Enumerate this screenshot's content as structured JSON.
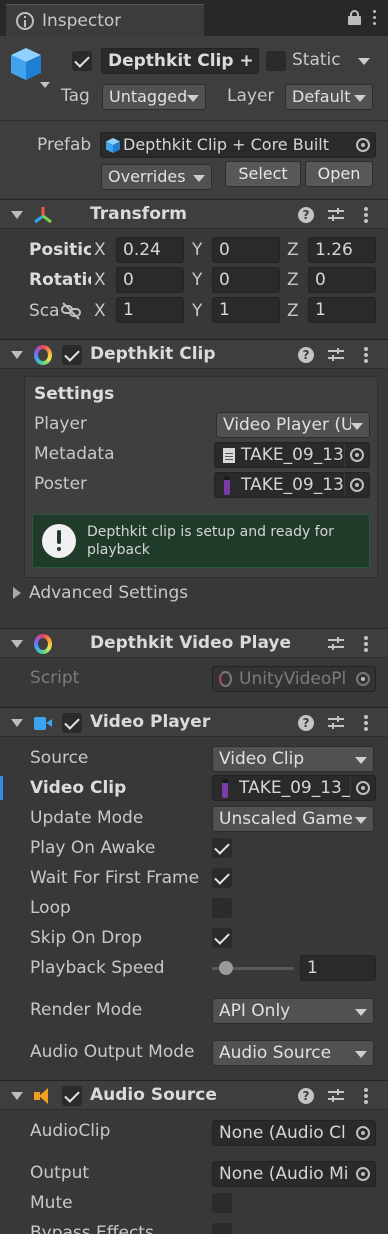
{
  "window": {
    "tab_title": "Inspector"
  },
  "header": {
    "name": "Depthkit Clip + C",
    "static_label": "Static",
    "tag_label": "Tag",
    "tag_value": "Untagged",
    "layer_label": "Layer",
    "layer_value": "Default",
    "prefab_label": "Prefab",
    "prefab_value": "Depthkit Clip + Core Built",
    "overrides_label": "Overrides",
    "select_label": "Select",
    "open_label": "Open"
  },
  "transform": {
    "title": "Transform",
    "position_label": "Positic",
    "rotation_label": "Rotatic",
    "scale_label": "Sca",
    "axis_x": "X",
    "axis_y": "Y",
    "axis_z": "Z",
    "position": {
      "x": "0.24",
      "y": "0",
      "z": "1.26"
    },
    "rotation": {
      "x": "0",
      "y": "0",
      "z": "0"
    },
    "scale": {
      "x": "1",
      "y": "1",
      "z": "1"
    }
  },
  "depthkit_clip": {
    "title": "Depthkit Clip",
    "settings_label": "Settings",
    "player_label": "Player",
    "player_value": "Video Player (U",
    "metadata_label": "Metadata",
    "metadata_value": "TAKE_09_13",
    "poster_label": "Poster",
    "poster_value": "TAKE_09_13",
    "message": "Depthkit clip is setup and ready for playback",
    "advanced_label": "Advanced Settings"
  },
  "depthkit_video_player": {
    "title": "Depthkit Video Playe",
    "script_label": "Script",
    "script_value": "UnityVideoPl"
  },
  "video_player": {
    "title": "Video Player",
    "source_label": "Source",
    "source_value": "Video Clip",
    "video_clip_label": "Video Clip",
    "video_clip_value": "TAKE_09_13_",
    "update_mode_label": "Update Mode",
    "update_mode_value": "Unscaled Game",
    "play_on_awake_label": "Play On Awake",
    "wait_first_frame_label": "Wait For First Frame",
    "loop_label": "Loop",
    "skip_on_drop_label": "Skip On Drop",
    "playback_speed_label": "Playback Speed",
    "playback_speed_value": "1",
    "render_mode_label": "Render Mode",
    "render_mode_value": "API Only",
    "audio_output_label": "Audio Output Mode",
    "audio_output_value": "Audio Source"
  },
  "audio_source": {
    "title": "Audio Source",
    "audioclip_label": "AudioClip",
    "audioclip_value": "None (Audio Cl",
    "output_label": "Output",
    "output_value": "None (Audio Mi",
    "mute_label": "Mute",
    "bypass_label": "Bypass Effects"
  }
}
